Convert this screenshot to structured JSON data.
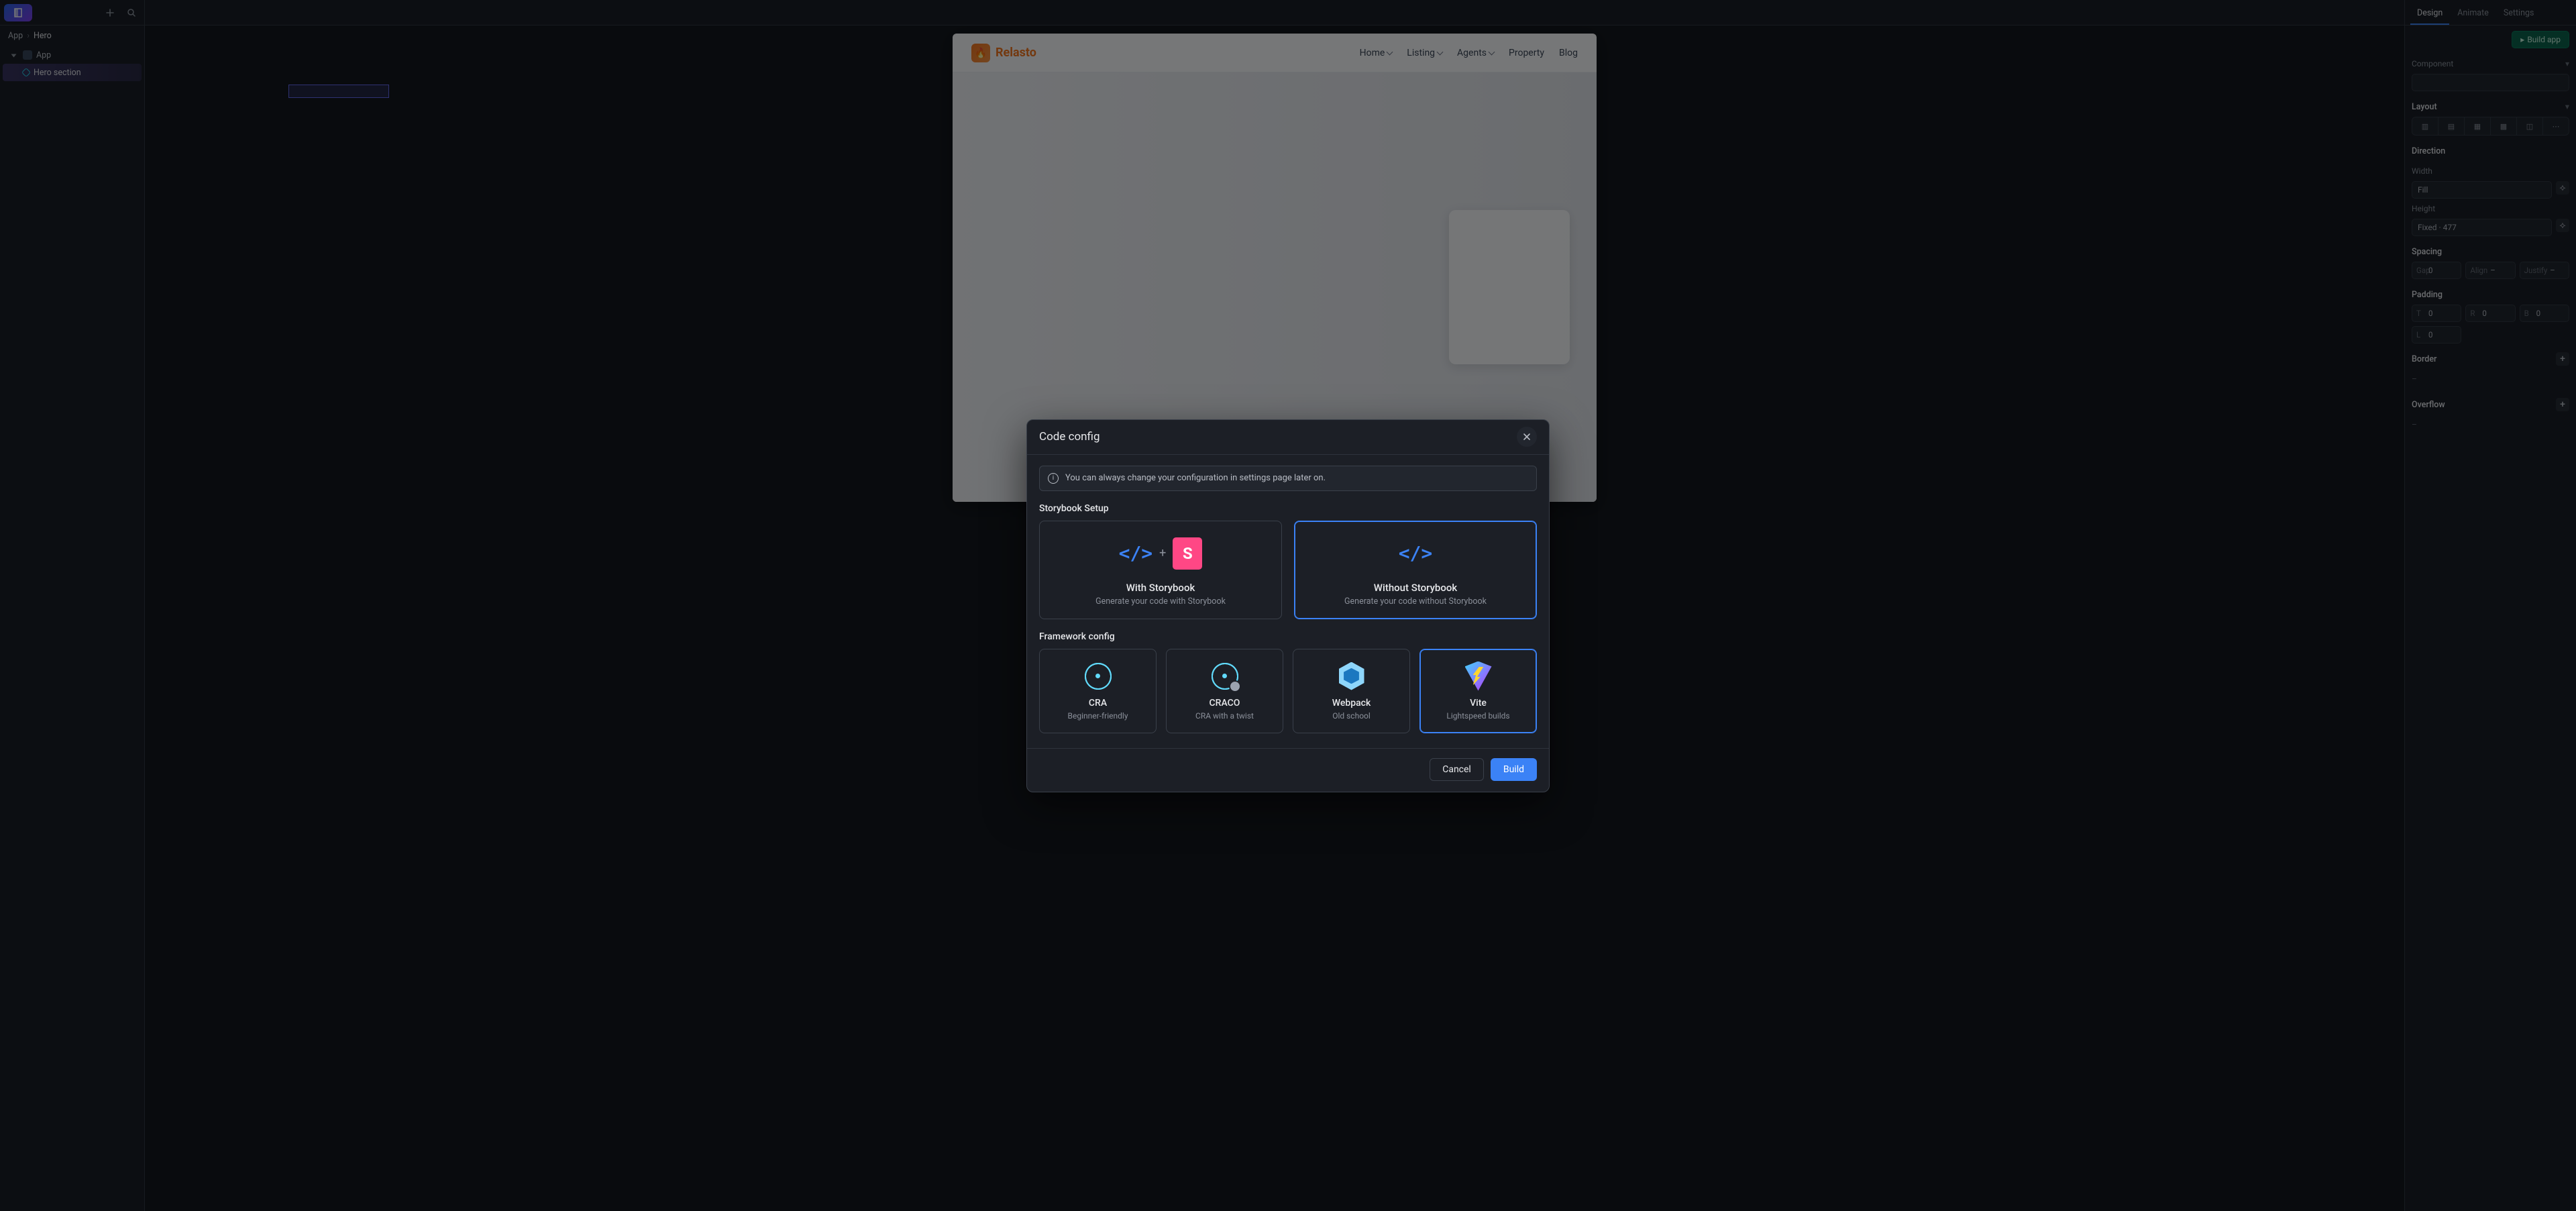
{
  "leftTopLogo": "◧",
  "breadcrumb": {
    "root": "App",
    "sep": "›",
    "current": "Hero"
  },
  "tree": {
    "root": "App",
    "child": "Hero section"
  },
  "site": {
    "brand": "Relasto",
    "menu": {
      "home": "Home",
      "listing": "Listing",
      "agents": "Agents",
      "property": "Property",
      "blog": "Blog"
    }
  },
  "rightTabs": {
    "design": "Design",
    "animate": "Animate",
    "settings": "Settings"
  },
  "rightPanel": {
    "buildBtn": "Build app",
    "componentLabel": "Component",
    "componentVal": "",
    "layoutHead": "Layout",
    "directionHead": "Direction",
    "widthLbl": "Width",
    "widthVal": "Fill",
    "heightLbl": "Height",
    "heightVal": "Fixed · 477",
    "spacingHead": "Spacing",
    "paddingHead": "Padding",
    "borderHead": "Border",
    "overflowHead": "Overflow",
    "gap": {
      "k": "Gap",
      "v": "0"
    },
    "align": {
      "k": "Align",
      "v": "–"
    },
    "justify": {
      "k": "Justify",
      "v": "–"
    },
    "pad": {
      "t": {
        "k": "T",
        "v": "0"
      },
      "r": {
        "k": "R",
        "v": "0"
      },
      "b": {
        "k": "B",
        "v": "0"
      },
      "l": {
        "k": "L",
        "v": "0"
      }
    },
    "dash": "–"
  },
  "modal": {
    "title": "Code config",
    "info": "You can always change your configuration in settings page later on.",
    "storybookHead": "Storybook Setup",
    "frameworkHead": "Framework config",
    "withSB": {
      "title": "With Storybook",
      "sub": "Generate your code with Storybook"
    },
    "withoutSB": {
      "title": "Without Storybook",
      "sub": "Generate your code without Storybook"
    },
    "cra": {
      "title": "CRA",
      "sub": "Beginner-friendly"
    },
    "craco": {
      "title": "CRACO",
      "sub": "CRA with a twist"
    },
    "webpack": {
      "title": "Webpack",
      "sub": "Old school"
    },
    "vite": {
      "title": "Vite",
      "sub": "Lightspeed builds"
    },
    "cancel": "Cancel",
    "build": "Build"
  }
}
